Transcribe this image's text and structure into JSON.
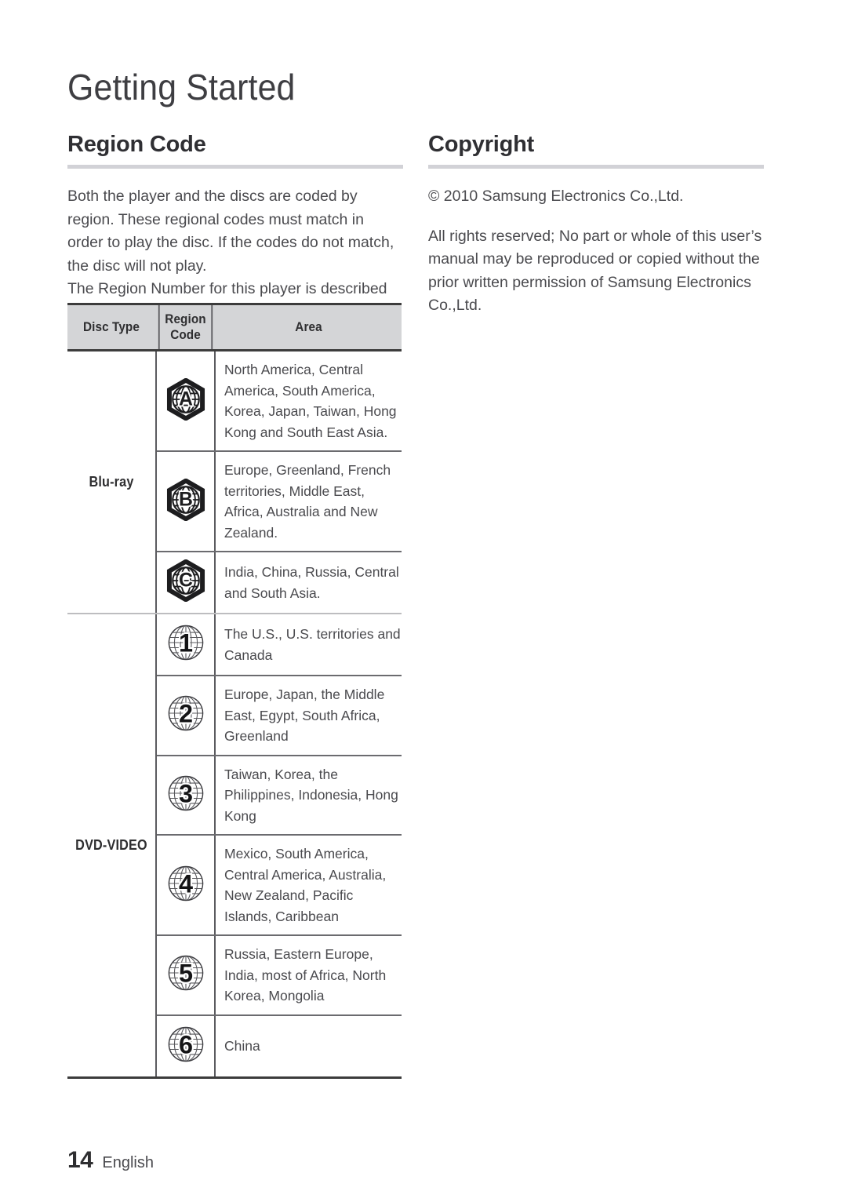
{
  "page": {
    "chapter_title": "Getting Started",
    "footer_page_number": "14",
    "footer_language": "English",
    "rule_color": "#d2d2d7",
    "header_fill": "#d4d5d7",
    "text_color": "#4a4a4e"
  },
  "left_column": {
    "heading": "Region Code",
    "paragraph_1": "Both the player and the discs are coded by region. These regional codes must match in order to play the disc. If the codes do not match, the disc will not play.",
    "paragraph_2": "The Region Number for this player is described on the bottom panel of the player."
  },
  "right_column": {
    "heading": "Copyright",
    "paragraph_1": "© 2010 Samsung Electronics Co.,Ltd.",
    "paragraph_2": "All rights reserved; No part or whole of this user’s manual may be reproduced or copied without the prior written permission of Samsung Electronics Co.,Ltd."
  },
  "region_table": {
    "headers": {
      "disc_type": "Disc Type",
      "region_code": "Region\nCode",
      "region_code_line1": "Region",
      "region_code_line2": "Code",
      "area": "Area"
    },
    "groups": [
      {
        "disc_type": "Blu-ray",
        "icon_style": "hexagon-globe",
        "rows": [
          {
            "code": "A",
            "icon_name": "bluray-region-a-icon",
            "area": "North America, Central America, South America, Korea, Japan, Taiwan, Hong Kong and South East Asia."
          },
          {
            "code": "B",
            "icon_name": "bluray-region-b-icon",
            "area": "Europe, Greenland, French territories, Middle East, Africa, Australia and New Zealand."
          },
          {
            "code": "C",
            "icon_name": "bluray-region-c-icon",
            "area": "India, China, Russia, Central and South Asia."
          }
        ]
      },
      {
        "disc_type": "DVD-VIDEO",
        "icon_style": "circle-globe",
        "rows": [
          {
            "code": "1",
            "icon_name": "dvd-region-1-icon",
            "area": "The U.S., U.S. territories and Canada"
          },
          {
            "code": "2",
            "icon_name": "dvd-region-2-icon",
            "area": "Europe, Japan, the Middle East, Egypt, South Africa, Greenland"
          },
          {
            "code": "3",
            "icon_name": "dvd-region-3-icon",
            "area": "Taiwan, Korea, the Philippines, Indonesia, Hong Kong"
          },
          {
            "code": "4",
            "icon_name": "dvd-region-4-icon",
            "area": "Mexico, South America, Central America, Australia, New Zealand, Pacific Islands, Caribbean"
          },
          {
            "code": "5",
            "icon_name": "dvd-region-5-icon",
            "area": "Russia, Eastern Europe, India, most of Africa, North Korea, Mongolia"
          },
          {
            "code": "6",
            "icon_name": "dvd-region-6-icon",
            "area": "China"
          }
        ]
      }
    ]
  }
}
